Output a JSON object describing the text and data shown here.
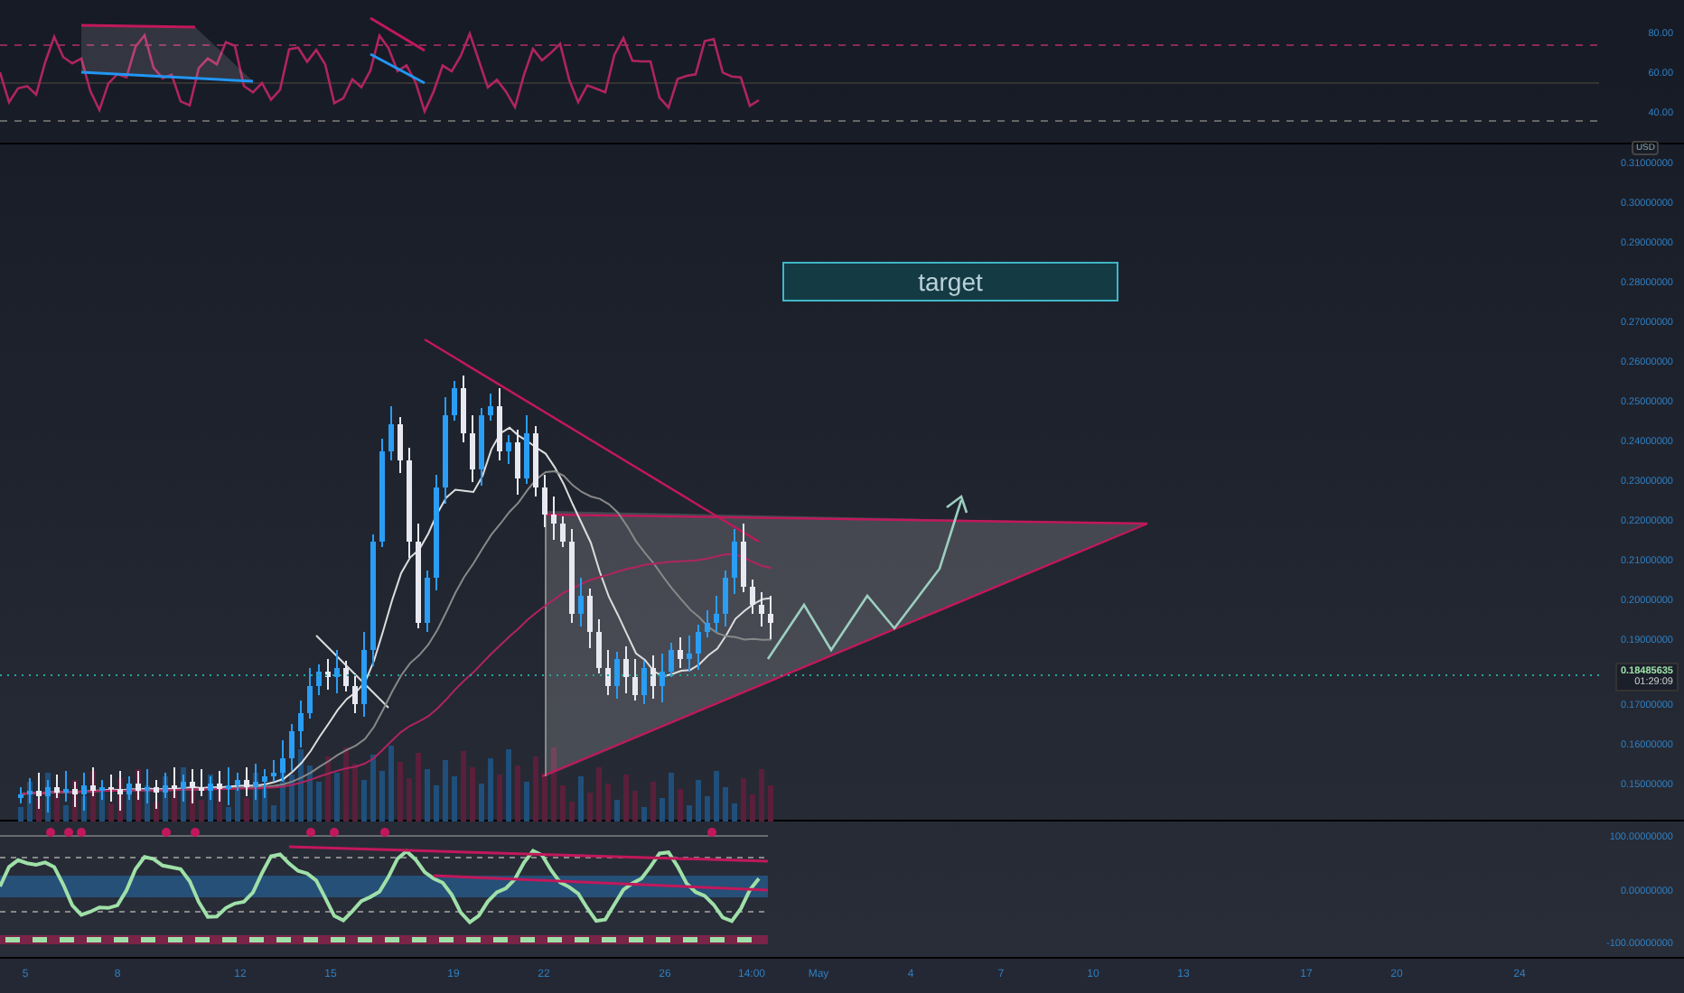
{
  "rsi_axis": {
    "labels": [
      "80.00",
      "60.00",
      "40.00"
    ]
  },
  "price_axis": {
    "currency": "USD",
    "labels": [
      "0.31000000",
      "0.30000000",
      "0.29000000",
      "0.28000000",
      "0.27000000",
      "0.26000000",
      "0.25000000",
      "0.24000000",
      "0.23000000",
      "0.22000000",
      "0.21000000",
      "0.20000000",
      "0.19000000",
      "0.17000000",
      "0.16000000",
      "0.15000000"
    ]
  },
  "last_price": {
    "value": "0.18485635",
    "countdown": "01:29:09"
  },
  "annotation": {
    "text": "target"
  },
  "oscillator_axis": {
    "labels": [
      "100.00000000",
      "0.00000000",
      "-100.00000000"
    ]
  },
  "time_axis": {
    "labels": [
      "5",
      "8",
      "12",
      "15",
      "19",
      "22",
      "26",
      "14:00",
      "May",
      "4",
      "7",
      "10",
      "13",
      "17",
      "20",
      "24"
    ]
  }
}
